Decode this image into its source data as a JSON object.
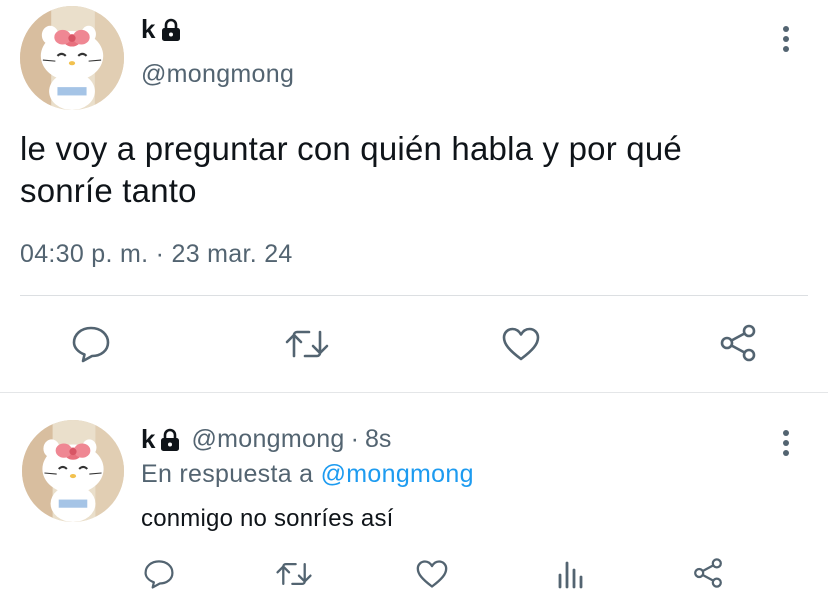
{
  "main_tweet": {
    "author_name": "k",
    "handle": "@mongmong",
    "text_line1": "le voy a preguntar con quién habla y por qué",
    "text_line2": "sonríe tanto",
    "timestamp": "04:30 p. m. · 23 mar. 24",
    "icons": {
      "lock": "lock-icon",
      "more": "more-vertical-icon",
      "reply": "reply-bubble-icon",
      "retweet": "retweet-icon",
      "like": "heart-icon",
      "share": "share-nodes-icon"
    }
  },
  "reply_tweet": {
    "author_name": "k",
    "handle": "@mongmong",
    "separator": "·",
    "time_ago": "8s",
    "reply_prefix": "En respuesta a",
    "reply_mention": "@mongmong",
    "text": "conmigo no sonríes así",
    "icons": {
      "reply": "reply-bubble-icon",
      "retweet": "retweet-icon",
      "like": "heart-icon",
      "views": "analytics-bars-icon",
      "share": "share-nodes-icon"
    }
  },
  "colors": {
    "text_primary": "#0f1419",
    "text_secondary": "#536471",
    "link": "#1d9bf0",
    "divider": "#dcdfe2"
  }
}
